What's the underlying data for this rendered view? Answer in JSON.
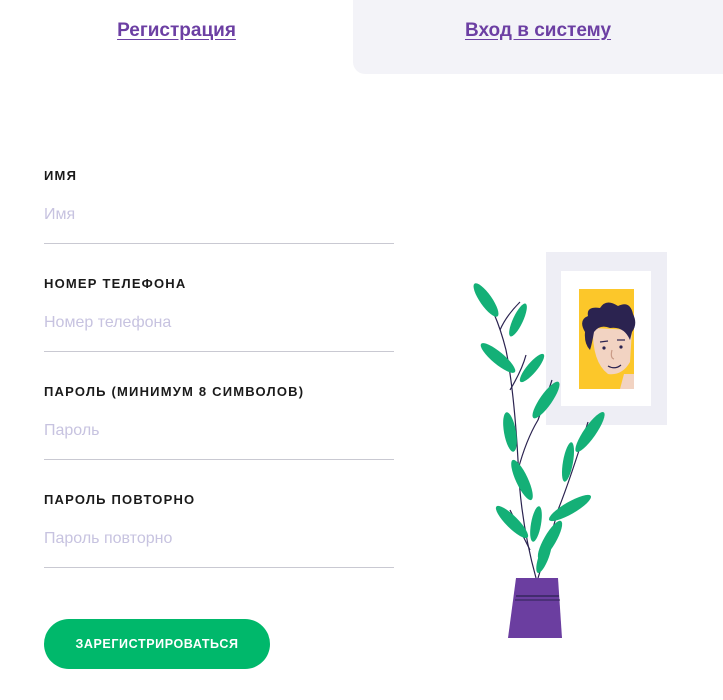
{
  "tabs": {
    "register_label": "Регистрация",
    "login_label": "Вход в систему"
  },
  "form": {
    "name": {
      "label": "ИМЯ",
      "placeholder": "Имя"
    },
    "phone": {
      "label": "НОМЕР ТЕЛЕФОНА",
      "placeholder": "Номер телефона"
    },
    "password": {
      "label": "ПАРОЛЬ (МИНИМУМ 8 СИМВОЛОВ)",
      "placeholder": "Пароль"
    },
    "password_repeat": {
      "label": "ПАРОЛЬ ПОВТОРНО",
      "placeholder": "Пароль повторно"
    },
    "submit_label": "ЗАРЕГИСТРИРОВАТЬСЯ"
  },
  "colors": {
    "accent_purple": "#6c3fa3",
    "button_green": "#00b86b",
    "placeholder": "#c7c3e0",
    "tab_inactive_bg": "#f3f3f8"
  },
  "illustration": {
    "icon": "plant-and-portrait-illustration"
  }
}
